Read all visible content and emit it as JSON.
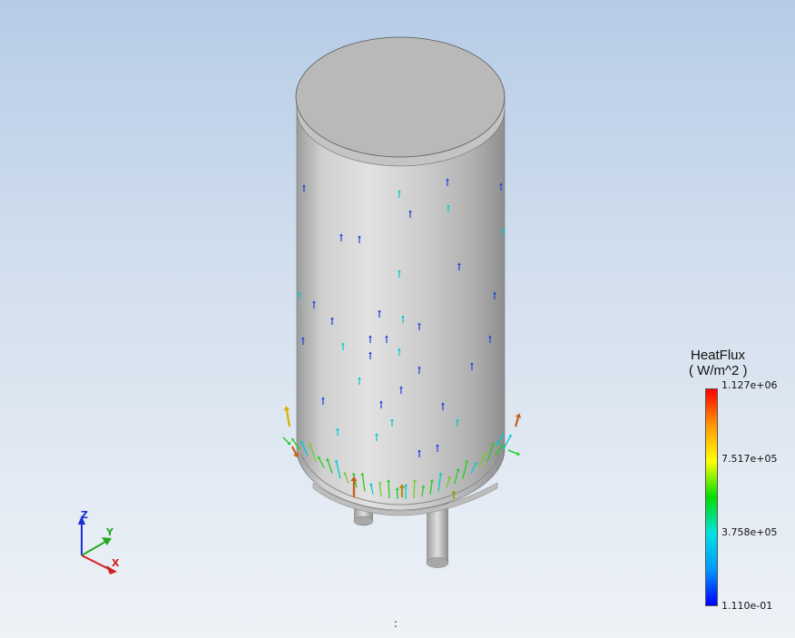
{
  "legend": {
    "title": "HeatFlux",
    "units": "( W/m^2 )",
    "ticks": [
      "1.127e+06",
      "7.517e+05",
      "3.758e+05",
      "1.110e-01"
    ],
    "colors": [
      "#ff0000",
      "#ff9900",
      "#ffff00",
      "#00dd00",
      "#00e0e0",
      "#0099ff",
      "#0000ff"
    ]
  },
  "triad": {
    "z": "Z",
    "y": "Y",
    "x": "X"
  },
  "status": {
    "text": ":"
  },
  "colors": {
    "background_top": "#b6cce6",
    "background_bottom": "#eef2f7",
    "tank_body": "#c8c8c8",
    "vector_high": "#c8601a",
    "vector_mid": "#22cc22",
    "vector_low": "#00cccc"
  }
}
